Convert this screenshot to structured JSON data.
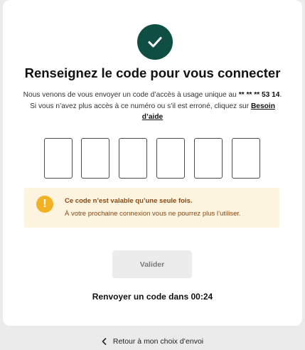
{
  "header": {
    "title": "Renseignez le code pour vous connecter"
  },
  "instructions": {
    "text_before": "Nous venons de vous envoyer un code d’accès à usage unique au ",
    "phone_masked": "** ** ** 53 14",
    "text_after": ". Si vous n’avez plus accès à ce numéro ou s’il est erroné, cliquez sur ",
    "help_link": "Besoin d’aide"
  },
  "otp": {
    "digits": [
      "",
      "",
      "",
      "",
      "",
      ""
    ]
  },
  "alert": {
    "title": "Ce code n’est valable qu’une seule fois.",
    "text": "À votre prochaine connexion vous ne pourrez plus l’utiliser.",
    "icon": "exclamation-icon",
    "color": "#f3b223"
  },
  "actions": {
    "submit_label": "Valider",
    "resend_text": "Renvoyer un code dans 00:24"
  },
  "footer": {
    "back_label": "Retour à mon choix d’envoi"
  },
  "colors": {
    "accent": "#0f4f43",
    "alert_bg": "#fdf4df",
    "alert_text": "#8a4711"
  }
}
